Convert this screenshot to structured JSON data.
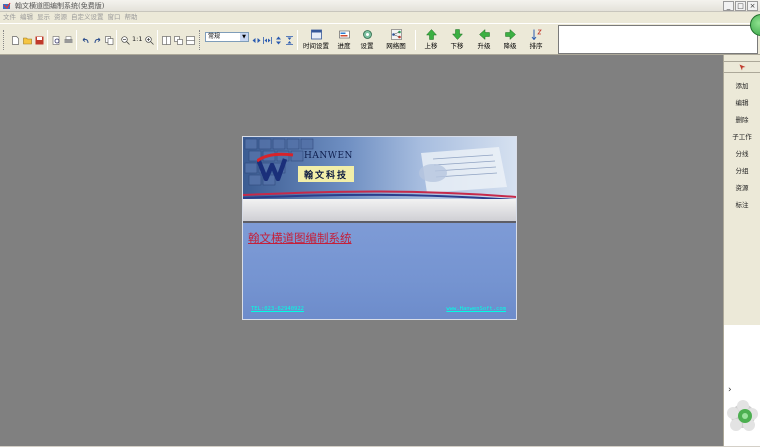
{
  "window": {
    "title": "翰文横道图编制系统(免费版)",
    "controls": {
      "minimize": "_",
      "maximize": "□",
      "close": "×"
    }
  },
  "menu": {
    "items": [
      "文件",
      "编辑",
      "显示",
      "资源",
      "自定义设置",
      "窗口",
      "帮助"
    ]
  },
  "toolbar": {
    "zoom_label": "1:1",
    "style_select": {
      "value": "常规"
    },
    "big_buttons": [
      "时间设置",
      "进度",
      "设置",
      "网络图",
      "上移",
      "下移",
      "升级",
      "降级",
      "排序"
    ]
  },
  "right_panel": {
    "items": [
      "添加",
      "编辑",
      "删除",
      "子工作",
      "分线",
      "分组",
      "资源",
      "标注"
    ],
    "chevron": "›"
  },
  "splash": {
    "brand_en": "HANWEN",
    "brand_cn": "翰文科技",
    "title": "翰文横道图编制系统",
    "tel": "TEL:023-62940922",
    "url": "www.HanwenSoft.com"
  },
  "colors": {
    "workspace": "#808080",
    "chrome": "#ece9d8",
    "splash_title": "#c4203a",
    "splash_links": "#00ffe4",
    "splash_body": "#7594d1"
  }
}
